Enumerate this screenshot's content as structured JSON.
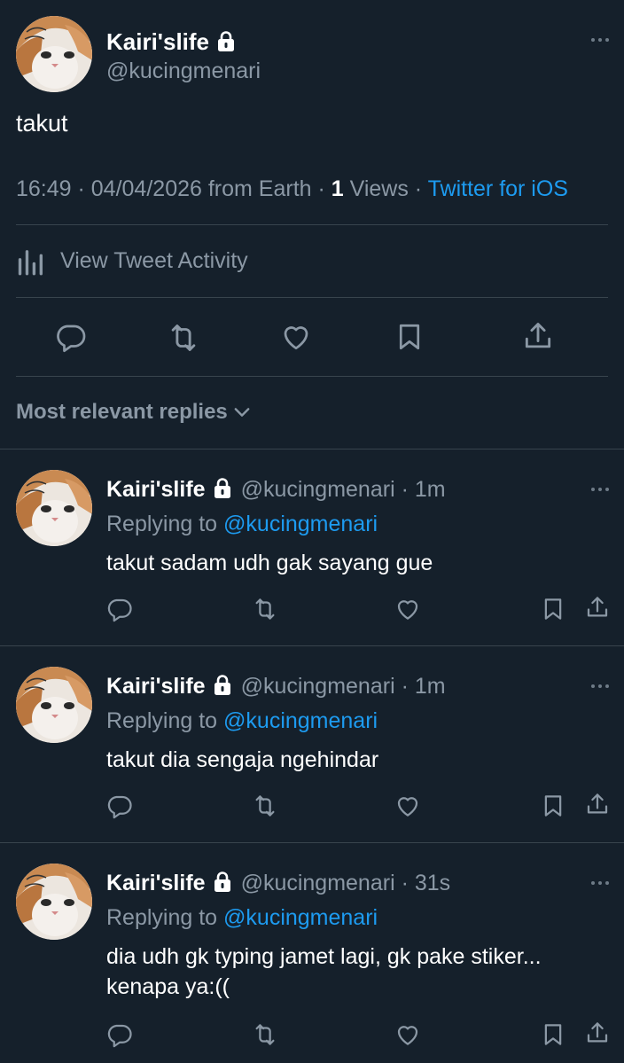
{
  "main_tweet": {
    "display_name": "Kairi'slife",
    "handle": "@kucingmenari",
    "text": "takut",
    "meta_time": "16:49 · 04/04/2026 from Earth · ",
    "views_count": "1",
    "views_label": " Views · ",
    "source": "Twitter for iOS"
  },
  "activity": {
    "label": "View Tweet Activity"
  },
  "replies_header": {
    "label": "Most relevant replies"
  },
  "replies": [
    {
      "display_name": "Kairi'slife",
      "handle": "@kucingmenari · 1m",
      "replying_prefix": "Replying to ",
      "replying_to": "@kucingmenari",
      "text": "takut sadam udh gak sayang gue"
    },
    {
      "display_name": "Kairi'slife",
      "handle": "@kucingmenari · 1m",
      "replying_prefix": "Replying to ",
      "replying_to": "@kucingmenari",
      "text": "takut dia sengaja ngehindar"
    },
    {
      "display_name": "Kairi'slife",
      "handle": "@kucingmenari · 31s",
      "replying_prefix": "Replying to ",
      "replying_to": "@kucingmenari",
      "text": "dia udh gk typing jamet lagi, gk pake stiker... kenapa ya:(("
    }
  ],
  "theme": {
    "background": "#15202b",
    "muted": "#8b98a5",
    "link": "#1d9bf0",
    "divider": "#38444d",
    "icon": "#8b98a5"
  }
}
